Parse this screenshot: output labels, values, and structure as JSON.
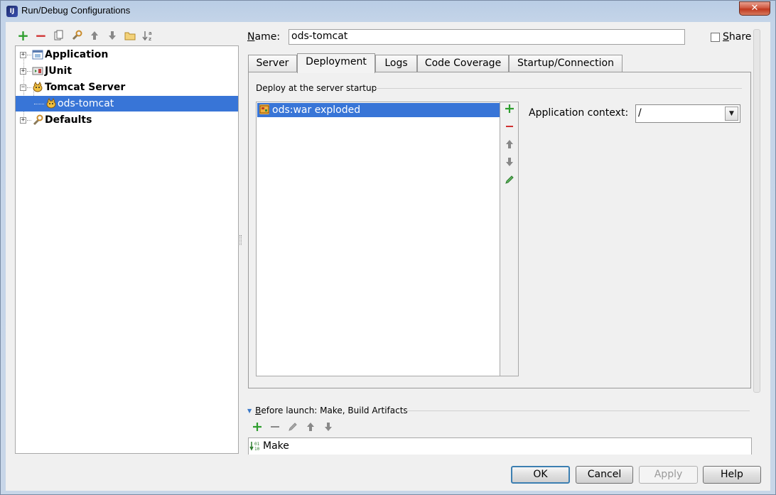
{
  "window": {
    "title": "Run/Debug Configurations",
    "icon_text": "IJ",
    "close_glyph": "✕"
  },
  "left_toolbar": [
    {
      "name": "add-config-button",
      "glyph": "+",
      "cls": "tb-add"
    },
    {
      "name": "remove-config-button",
      "glyph": "−",
      "cls": "tb-remove"
    },
    {
      "name": "copy-config-button",
      "glyph": "⎘",
      "cls": ""
    },
    {
      "name": "edit-defaults-button",
      "glyph": "🔧",
      "cls": ""
    },
    {
      "name": "move-up-button",
      "glyph": "↑",
      "cls": ""
    },
    {
      "name": "move-down-button",
      "glyph": "↓",
      "cls": ""
    },
    {
      "name": "folder-button",
      "glyph": "▭",
      "cls": ""
    },
    {
      "name": "sort-button",
      "glyph": "↓z",
      "cls": ""
    }
  ],
  "tree": {
    "items": [
      {
        "label": "Application",
        "icon": "application-icon"
      },
      {
        "label": "JUnit",
        "icon": "junit-icon"
      },
      {
        "label": "Tomcat Server",
        "icon": "tomcat-icon"
      },
      {
        "label": "ods-tomcat",
        "icon": "tomcat-icon"
      },
      {
        "label": "Defaults",
        "icon": "wrench-icon"
      }
    ]
  },
  "config": {
    "name_label_prefix": "N",
    "name_label_rest": "ame:",
    "name_value": "ods-tomcat",
    "share_label_prefix": "S",
    "share_label_rest": "hare"
  },
  "tabs": [
    "Server",
    "Deployment",
    "Logs",
    "Code Coverage",
    "Startup/Connection"
  ],
  "active_tab": "Deployment",
  "deployment": {
    "group_label": "Deploy at the server startup",
    "items": [
      "ods:war exploded"
    ],
    "context_label": "Application context:",
    "context_value": "/"
  },
  "before_launch": {
    "label_prefix": "B",
    "label_rest": "efore launch: Make, Build Artifacts",
    "items": [
      "Make"
    ]
  },
  "buttons": {
    "ok": "OK",
    "cancel": "Cancel",
    "apply": "Apply",
    "help": "Help"
  },
  "colors": {
    "selection": "#3875d7",
    "add_green": "#2e9e2e",
    "remove_red": "#d03030"
  }
}
